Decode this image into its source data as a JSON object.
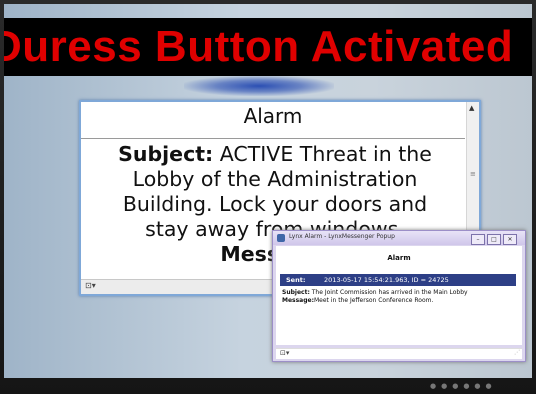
{
  "banner": {
    "text": "Duress Button Activated"
  },
  "alarm_window": {
    "title": "Alarm",
    "subject_label": "Subject:",
    "subject_line1": "ACTIVE Threat in the",
    "subject_line2": "Lobby of the Administration",
    "subject_line3": "Building. Lock your doors and",
    "subject_line4": "stay away from windows.",
    "message_label": "Message:"
  },
  "popup": {
    "window_title": "Lynx Alarm - LynxMessenger Popup",
    "title": "Alarm",
    "sent_label": "Sent:",
    "sent_value": "2013-05-17 15:54:21.963, ID = 24725",
    "subject_label": "Subject:",
    "subject_text": "The Joint Commission has arrived in the Main Lobby",
    "message_label": "Message:",
    "message_text": "Meet in the Jefferson Conference Room."
  },
  "colors": {
    "banner_text": "#e00000",
    "banner_bg": "#000000",
    "sent_bar": "#2d3f86",
    "popup_frame": "#dcd6ee"
  },
  "icons": {
    "window_min": "minimize-icon",
    "window_max": "maximize-icon",
    "window_close": "close-icon"
  }
}
